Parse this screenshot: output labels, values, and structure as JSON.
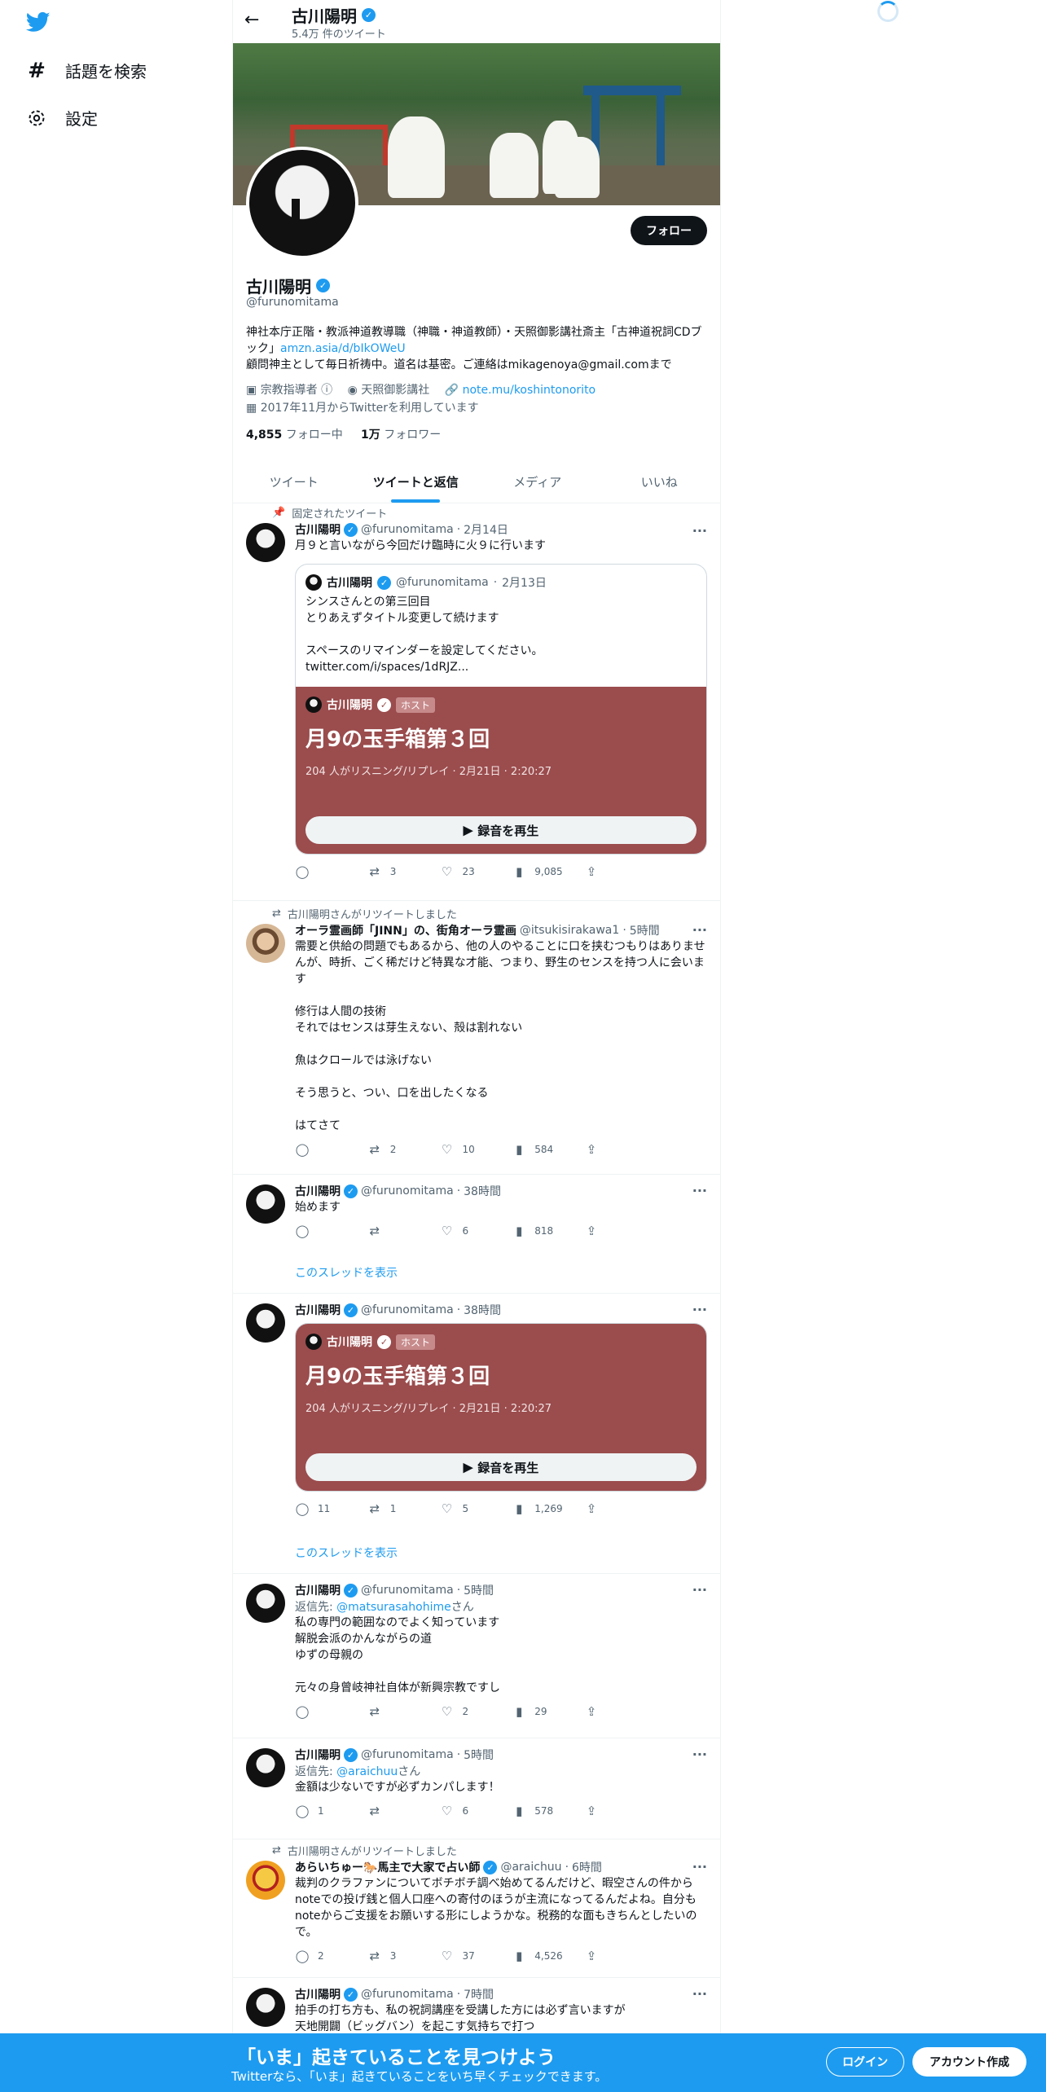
{
  "nav": {
    "items": [
      {
        "label": "話題を検索",
        "icon": "hashtag-icon"
      },
      {
        "label": "設定",
        "icon": "gear-icon"
      }
    ]
  },
  "header": {
    "name": "古川陽明",
    "tweet_count": "5.4万 件のツイート"
  },
  "profile": {
    "follow_label": "フォロー",
    "name": "古川陽明",
    "handle": "@furunomitama",
    "bio_line1": "神社本庁正階・教派神道教導職（神職・神道教師）・天照御影講社斎主「古神道祝詞CDブック」",
    "bio_link": "amzn.asia/d/bIkOWeU",
    "bio_line2": "顧問神主として毎日祈祷中。道名は基密。ご連絡はmikagenoya@gmail.comまで",
    "category": "宗教指導者",
    "location": "天照御影講社",
    "website": "note.mu/koshintonorito",
    "joined": "2017年11月からTwitterを利用しています",
    "following_count": "4,855",
    "following_label": "フォロー中",
    "followers_count": "1万",
    "followers_label": "フォロワー"
  },
  "tabs": [
    "ツイート",
    "ツイートと返信",
    "メディア",
    "いいね"
  ],
  "tweets": [
    {
      "context": "固定されたツイート",
      "name": "古川陽明",
      "handle": "@furunomitama",
      "time": "2月14日",
      "text": "月９と言いながら今回だけ臨時に火９に行います",
      "quote": {
        "name": "古川陽明",
        "handle": "@furunomitama",
        "time": "2月13日",
        "text": "シンスさんとの第三回目\nとりあえずタイトル変更して続けます\n\nスペースのリマインダーを設定してください。\ntwitter.com/i/spaces/1dRJZ..."
      },
      "space": {
        "host_name": "古川陽明",
        "host_badge": "ホスト",
        "title": "月9の玉手箱第３回",
        "sub": "204 人がリスニング/リプレイ · 2月21日 · 2:20:27",
        "play": "録音を再生"
      },
      "replies": "",
      "retweets": "3",
      "likes": "23",
      "views": "9,085"
    },
    {
      "context": "古川陽明さんがリツイートしました",
      "name": "オーラ霊画師「JINN」の、街角オーラ霊画",
      "handle": "@itsukisirakawa1",
      "time": "5時間",
      "text": "需要と供給の問題でもあるから、他の人のやることに口を挟むつもりはありませんが、時折、ごく稀だけど特異な才能、つまり、野生のセンスを持つ人に会います\n\n修行は人間の技術\nそれではセンスは芽生えない、殻は割れない\n\n魚はクロールでは泳げない\n\nそう思うと、つい、口を出したくなる\n\nはてさて",
      "replies": "",
      "retweets": "2",
      "likes": "10",
      "views": "584"
    },
    {
      "name": "古川陽明",
      "handle": "@furunomitama",
      "time": "38時間",
      "text": "始めます",
      "replies": "",
      "retweets": "",
      "likes": "6",
      "views": "818",
      "show_thread": "このスレッドを表示"
    },
    {
      "name": "古川陽明",
      "handle": "@furunomitama",
      "time": "38時間",
      "space": {
        "host_name": "古川陽明",
        "host_badge": "ホスト",
        "title": "月9の玉手箱第３回",
        "sub": "204 人がリスニング/リプレイ · 2月21日 · 2:20:27",
        "play": "録音を再生"
      },
      "replies": "11",
      "retweets": "1",
      "likes": "5",
      "views": "1,269",
      "show_thread": "このスレッドを表示"
    },
    {
      "name": "古川陽明",
      "handle": "@furunomitama",
      "time": "5時間",
      "reply_prefix": "返信先: ",
      "reply_to": "@matsurasahohime",
      "reply_suffix": "さん",
      "text": "私の専門の範囲なのでよく知っています\n解脱会派のかんながらの道\nゆずの母親の\n\n元々の身曾岐神社自体が新興宗教ですし",
      "replies": "",
      "retweets": "",
      "likes": "2",
      "views": "29"
    },
    {
      "name": "古川陽明",
      "handle": "@furunomitama",
      "time": "5時間",
      "reply_prefix": "返信先: ",
      "reply_to": "@araichuu",
      "reply_suffix": "さん",
      "text": "金額は少ないですが必ずカンパします！",
      "replies": "1",
      "retweets": "",
      "likes": "6",
      "views": "578"
    },
    {
      "context": "古川陽明さんがリツイートしました",
      "name": "あらいちゅー🐎馬主で大家で占い師",
      "handle": "@araichuu",
      "time": "6時間",
      "text": "裁判のクラファンについてボチボチ調べ始めてるんだけど、暇空さんの件からnoteでの投げ銭と個人口座への寄付のほうが主流になってるんだよね。自分もnoteからご支援をお願いする形にしようかな。税務的な面もきちんとしたいので。",
      "replies": "2",
      "retweets": "3",
      "likes": "37",
      "views": "4,526"
    },
    {
      "name": "古川陽明",
      "handle": "@furunomitama",
      "time": "7時間",
      "text": "拍手の打ち方も、私の祝詞講座を受講した方には必ず言いますが\n天地開闢（ビッグバン）を起こす気持ちで打つ"
    }
  ],
  "bottom": {
    "title": "「いま」起きていることを見つけよう",
    "sub": "Twitterなら、「いま」起きていることをいち早くチェックできます。",
    "login": "ログイン",
    "signup": "アカウント作成"
  },
  "colors": {
    "accent": "#1d9bf0",
    "space_card": "#9b4c4d",
    "text": "#0f1419",
    "secondary": "#536471"
  }
}
